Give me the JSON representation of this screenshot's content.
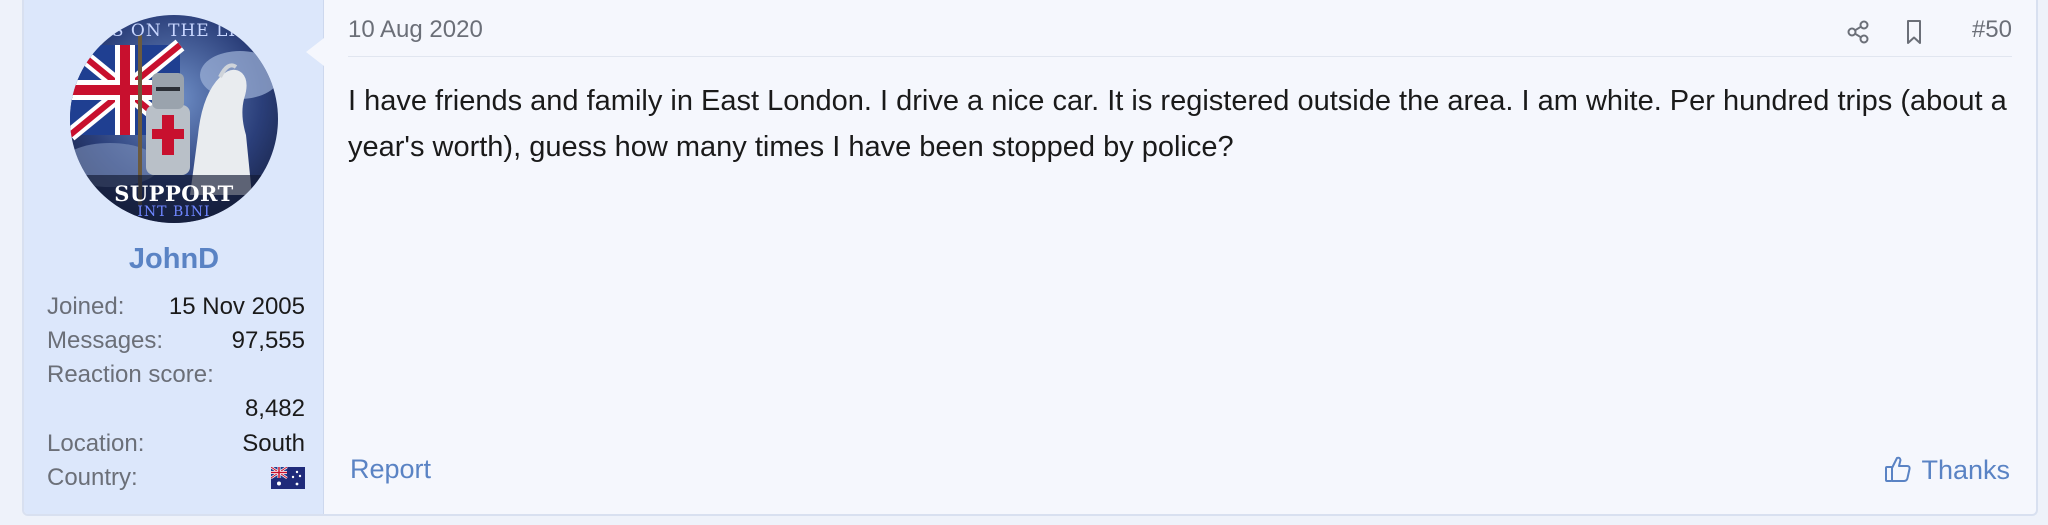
{
  "user": {
    "username": "JohnD",
    "avatar_text_top": "S ON THE LI",
    "avatar_text_bottom": "SUPPORT",
    "avatar_text_bottom2": "INT BINI",
    "info": [
      {
        "label": "Joined:",
        "value": "15 Nov 2005"
      },
      {
        "label": "Messages:",
        "value": "97,555"
      },
      {
        "label": "Reaction score:",
        "value": ""
      },
      {
        "label": "",
        "value": "8,482"
      },
      {
        "label": "Location:",
        "value": "South"
      },
      {
        "label": "Country:",
        "value": ""
      }
    ],
    "country_flag_icon": "australia-flag-icon"
  },
  "post": {
    "date": "10 Aug 2020",
    "number": "#50",
    "body": "I have friends and family in East London. I drive a nice car. It is registered outside the area. I am white. Per hundred trips (about a year's worth), guess how many times I have been stopped by police?",
    "report_label": "Report",
    "thanks_label": "Thanks"
  },
  "colors": {
    "accent": "#5a83c4",
    "sidebar_bg": "#dce7fb",
    "post_bg": "#f5f7fd",
    "muted_text": "#6b6f78"
  }
}
